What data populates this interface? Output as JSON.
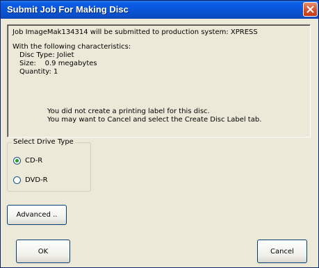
{
  "window": {
    "title": "Submit Job For Making Disc"
  },
  "info": {
    "line1": "Job ImageMak134314 will be submitted to production system: XPRESS",
    "line2": "With the following characteristics:",
    "disc_type": "Disc Type: Joliet",
    "size": "Size:    0.9 megabytes",
    "quantity": "Quantity: 1",
    "warning1": "You did not create a printing label for this disc.",
    "warning2": "You may want to Cancel and select the Create Disc Label tab."
  },
  "drive_type": {
    "legend": "Select Drive Type",
    "options": [
      {
        "label": "CD-R",
        "checked": true
      },
      {
        "label": "DVD-R",
        "checked": false
      }
    ]
  },
  "buttons": {
    "advanced": "Advanced ..",
    "ok": "OK",
    "cancel": "Cancel"
  },
  "colors": {
    "titlebar": "#0a55d8",
    "close": "#d4512e",
    "face": "#ece9d8",
    "radio_dot": "#21a121"
  }
}
